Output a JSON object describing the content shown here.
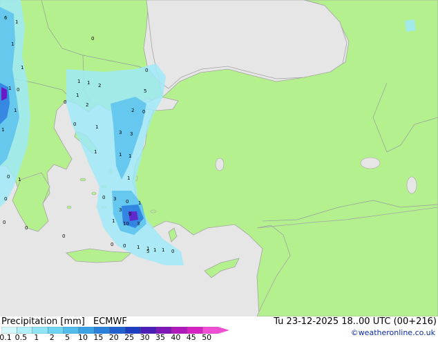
{
  "header": {
    "title": "Precipitation [mm]",
    "model": "ECMWF",
    "valid_time": "Tu 23-12-2025 18..00 UTC (00+216)",
    "credit": "©weatheronline.co.uk"
  },
  "colors": {
    "sea": "#e6e6e6",
    "land": "#b5f08f",
    "coast": "#a4a4a4",
    "precip_light": "#9fe9f7",
    "precip_mid": "#5bc2ec",
    "precip_heavy": "#2e7de0",
    "precip_extreme": "#6a1bc8"
  },
  "legend": {
    "labels": [
      "0.1",
      "0.5",
      "1",
      "2",
      "5",
      "10",
      "15",
      "20",
      "25",
      "30",
      "35",
      "40",
      "45",
      "50"
    ],
    "colors": [
      "#d4f8fd",
      "#b2f0fb",
      "#8fe4f6",
      "#6fd3f2",
      "#52bdec",
      "#3aa3e5",
      "#2a82dc",
      "#2061cf",
      "#1d3ec0",
      "#4a1eb6",
      "#7e18b6",
      "#b219bd",
      "#d722c3",
      "#f04fd3"
    ]
  },
  "map_values": [
    {
      "id": "v1",
      "text": "6"
    },
    {
      "id": "v2",
      "text": "1"
    },
    {
      "id": "v3",
      "text": "1"
    },
    {
      "id": "v4",
      "text": "0"
    },
    {
      "id": "v5",
      "text": "1"
    },
    {
      "id": "v6",
      "text": "0"
    },
    {
      "id": "v7",
      "text": "1"
    },
    {
      "id": "v8",
      "text": "0"
    },
    {
      "id": "v9",
      "text": "5"
    },
    {
      "id": "v10",
      "text": "1"
    },
    {
      "id": "v11",
      "text": "1"
    },
    {
      "id": "v12",
      "text": "2"
    },
    {
      "id": "v13",
      "text": "1"
    },
    {
      "id": "v14",
      "text": "1"
    },
    {
      "id": "v15",
      "text": "0"
    },
    {
      "id": "v16",
      "text": "2"
    },
    {
      "id": "v17",
      "text": "2"
    },
    {
      "id": "v18",
      "text": "0"
    },
    {
      "id": "v19",
      "text": "1"
    },
    {
      "id": "v20",
      "text": "3"
    },
    {
      "id": "v21",
      "text": "3"
    },
    {
      "id": "v22",
      "text": "1"
    },
    {
      "id": "v23",
      "text": "1"
    },
    {
      "id": "v24",
      "text": "1"
    },
    {
      "id": "v25",
      "text": "0"
    },
    {
      "id": "v26",
      "text": "0"
    },
    {
      "id": "v27",
      "text": "3"
    },
    {
      "id": "v28",
      "text": "0"
    },
    {
      "id": "v29",
      "text": "1"
    },
    {
      "id": "v30",
      "text": "1"
    },
    {
      "id": "v31",
      "text": "1"
    },
    {
      "id": "v32",
      "text": "3"
    },
    {
      "id": "v33",
      "text": "0"
    },
    {
      "id": "v34",
      "text": "0"
    },
    {
      "id": "v35",
      "text": "10"
    },
    {
      "id": "v36",
      "text": "3"
    },
    {
      "id": "v37",
      "text": "1"
    },
    {
      "id": "v38",
      "text": "1"
    },
    {
      "id": "v39",
      "text": "1"
    },
    {
      "id": "v40",
      "text": "0"
    },
    {
      "id": "v41",
      "text": "0"
    },
    {
      "id": "v42",
      "text": "1"
    },
    {
      "id": "v43",
      "text": "1"
    },
    {
      "id": "v44",
      "text": "1"
    },
    {
      "id": "v45",
      "text": "0"
    },
    {
      "id": "v46",
      "text": "0"
    },
    {
      "id": "v47",
      "text": "0"
    },
    {
      "id": "v48",
      "text": "0"
    },
    {
      "id": "v49",
      "text": "0"
    },
    {
      "id": "v50",
      "text": "5"
    }
  ]
}
